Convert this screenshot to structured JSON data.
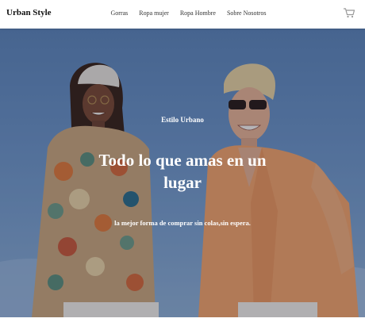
{
  "header": {
    "brand": "Urban Style",
    "nav": [
      "Gorras",
      "Ropa mujer",
      "Ropa Hombre",
      "Sobre Nosotros"
    ],
    "cart_icon": "shopping-cart-icon"
  },
  "hero": {
    "eyebrow": "Estilo Urbano",
    "headline": "Todo lo que amas en un lugar",
    "subtitle": "la mejor forma de comprar sin colas,sin espera."
  }
}
